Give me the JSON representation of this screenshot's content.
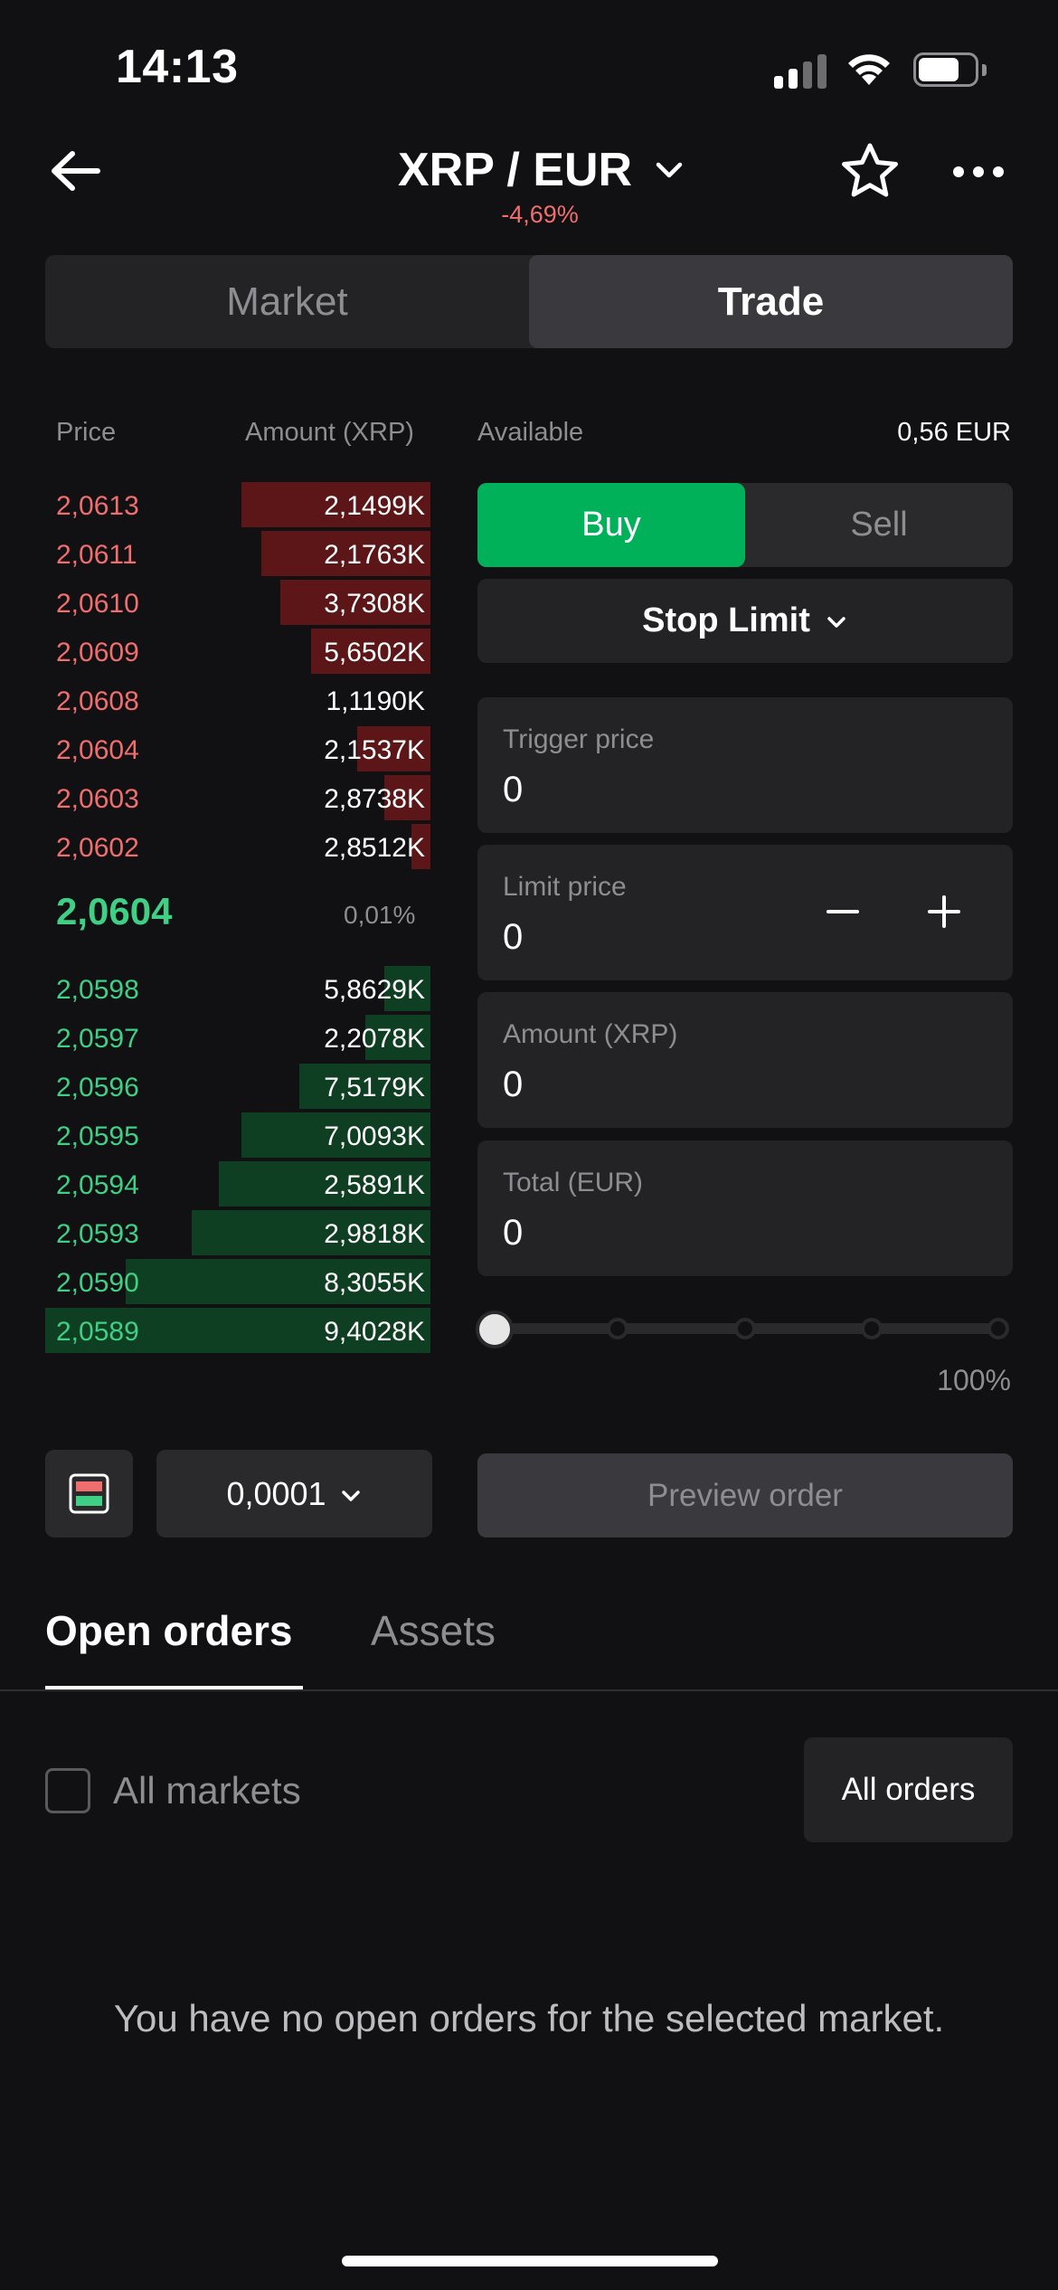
{
  "status_bar": {
    "time": "14:13"
  },
  "header": {
    "title": "XRP / EUR",
    "change": "-4,69%"
  },
  "segment": {
    "market_label": "Market",
    "trade_label": "Trade"
  },
  "orderbook": {
    "price_header": "Price",
    "amount_header": "Amount (XRP)",
    "asks": [
      {
        "price": "2,0613",
        "amount": "2,1499K",
        "depth": 0.49
      },
      {
        "price": "2,0611",
        "amount": "2,1763K",
        "depth": 0.44
      },
      {
        "price": "2,0610",
        "amount": "3,7308K",
        "depth": 0.39
      },
      {
        "price": "2,0609",
        "amount": "5,6502K",
        "depth": 0.31
      },
      {
        "price": "2,0608",
        "amount": "1,1190K",
        "depth": 0.0
      },
      {
        "price": "2,0604",
        "amount": "2,1537K",
        "depth": 0.19
      },
      {
        "price": "2,0603",
        "amount": "2,8738K",
        "depth": 0.12
      },
      {
        "price": "2,0602",
        "amount": "2,8512K",
        "depth": 0.05
      }
    ],
    "mid_price": "2,0604",
    "spread": "0,01%",
    "bids": [
      {
        "price": "2,0598",
        "amount": "5,8629K",
        "depth": 0.12
      },
      {
        "price": "2,0597",
        "amount": "2,2078K",
        "depth": 0.17
      },
      {
        "price": "2,0596",
        "amount": "7,5179K",
        "depth": 0.34
      },
      {
        "price": "2,0595",
        "amount": "7,0093K",
        "depth": 0.49
      },
      {
        "price": "2,0594",
        "amount": "2,5891K",
        "depth": 0.55
      },
      {
        "price": "2,0593",
        "amount": "2,9818K",
        "depth": 0.62
      },
      {
        "price": "2,0590",
        "amount": "8,3055K",
        "depth": 0.79
      },
      {
        "price": "2,0589",
        "amount": "9,4028K",
        "depth": 1.0
      }
    ]
  },
  "trade_panel": {
    "available_label": "Available",
    "available_value": "0,56 EUR",
    "buy_label": "Buy",
    "sell_label": "Sell",
    "order_type": "Stop Limit",
    "fields": {
      "trigger_label": "Trigger price",
      "trigger_value": "0",
      "limit_label": "Limit price",
      "limit_value": "0",
      "amount_label": "Amount (XRP)",
      "amount_value": "0",
      "total_label": "Total (EUR)",
      "total_value": "0"
    },
    "slider_value": 0,
    "slider_max_label": "100%",
    "preview_label": "Preview order"
  },
  "orderbook_controls": {
    "precision": "0,0001"
  },
  "tabs": {
    "open_orders": "Open orders",
    "assets": "Assets"
  },
  "filters": {
    "all_markets": "All markets",
    "all_orders": "All orders"
  },
  "empty_message": "You have no open orders for the selected market.",
  "colors": {
    "buy": "#00b15a",
    "sell_text": "#f06e6e",
    "bid_text": "#3fcf85",
    "ask_bar": "#5c1618",
    "bid_bar": "#0f3f22",
    "background": "#111113"
  }
}
